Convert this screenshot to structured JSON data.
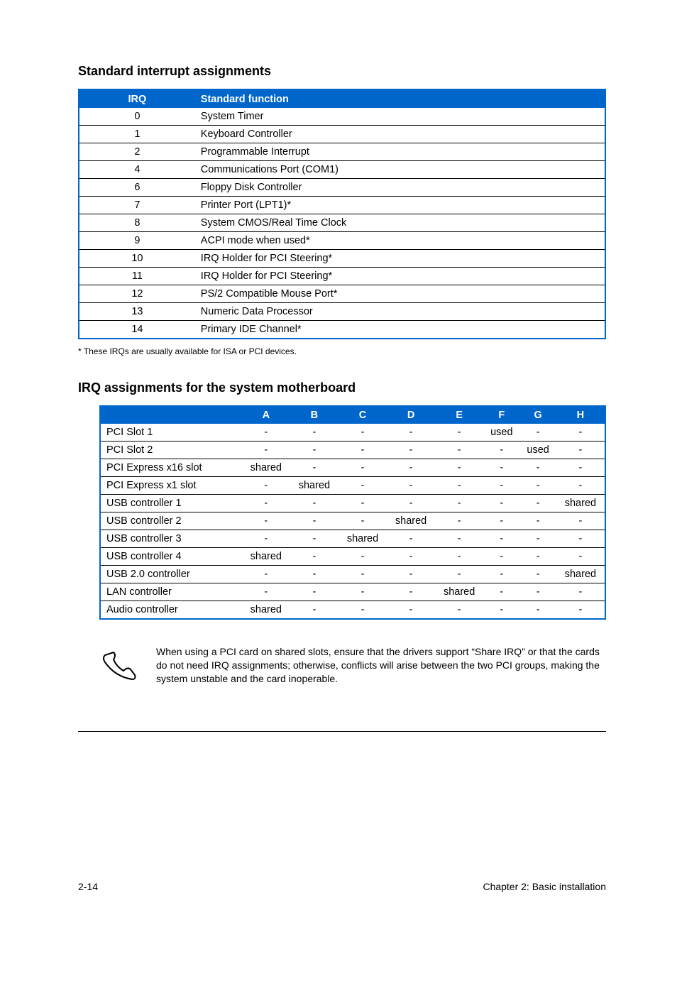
{
  "section1": {
    "title": "Standard interrupt assignments",
    "headers": {
      "irq": "IRQ",
      "func": "Standard function"
    },
    "rows": [
      {
        "irq": "0",
        "func": "System Timer"
      },
      {
        "irq": "1",
        "func": "Keyboard Controller"
      },
      {
        "irq": "2",
        "func": "Programmable Interrupt"
      },
      {
        "irq": "4",
        "func": "Communications Port (COM1)"
      },
      {
        "irq": "6",
        "func": "Floppy Disk Controller"
      },
      {
        "irq": "7",
        "func": "Printer Port (LPT1)*"
      },
      {
        "irq": "8",
        "func": "System CMOS/Real Time Clock"
      },
      {
        "irq": "9",
        "func": "ACPI mode when used*"
      },
      {
        "irq": "10",
        "func": "IRQ Holder for PCI Steering*"
      },
      {
        "irq": "11",
        "func": "IRQ Holder for PCI Steering*"
      },
      {
        "irq": "12",
        "func": "PS/2 Compatible Mouse Port*"
      },
      {
        "irq": "13",
        "func": "Numeric Data Processor"
      },
      {
        "irq": "14",
        "func": "Primary IDE Channel*"
      }
    ],
    "footnote": "* These IRQs are usually available for ISA or PCI devices."
  },
  "section2": {
    "title": "IRQ assignments for the system motherboard",
    "cols": [
      "A",
      "B",
      "C",
      "D",
      "E",
      "F",
      "G",
      "H"
    ],
    "rows": [
      {
        "label": "PCI Slot 1",
        "cells": [
          "-",
          "-",
          "-",
          "-",
          "-",
          "used",
          "-",
          "-"
        ]
      },
      {
        "label": "PCI Slot 2",
        "cells": [
          "-",
          "-",
          "-",
          "-",
          "-",
          "-",
          "used",
          "-"
        ]
      },
      {
        "label": "PCI Express x16 slot",
        "cells": [
          "shared",
          "-",
          "-",
          "-",
          "-",
          "-",
          "-",
          "-"
        ]
      },
      {
        "label": "PCI Express x1 slot",
        "cells": [
          "-",
          "shared",
          "-",
          "-",
          "-",
          "-",
          "-",
          "-"
        ]
      },
      {
        "label": "USB controller 1",
        "cells": [
          "-",
          "-",
          "-",
          "-",
          "-",
          "-",
          "-",
          "shared"
        ]
      },
      {
        "label": "USB controller 2",
        "cells": [
          "-",
          "-",
          "-",
          "shared",
          "-",
          "-",
          "-",
          "-"
        ]
      },
      {
        "label": "USB controller 3",
        "cells": [
          "-",
          "-",
          "shared",
          "-",
          "-",
          "-",
          "-",
          "-"
        ]
      },
      {
        "label": "USB controller 4",
        "cells": [
          "shared",
          "-",
          "-",
          "-",
          "-",
          "-",
          "-",
          "-"
        ]
      },
      {
        "label": "USB 2.0 controller",
        "cells": [
          "-",
          "-",
          "-",
          "-",
          "-",
          "-",
          "-",
          "shared"
        ]
      },
      {
        "label": "LAN controller",
        "cells": [
          "-",
          "-",
          "-",
          "-",
          "shared",
          "-",
          "-",
          "-"
        ]
      },
      {
        "label": "Audio controller",
        "cells": [
          "shared",
          "-",
          "-",
          "-",
          "-",
          "-",
          "-",
          "-"
        ]
      }
    ]
  },
  "note": "When using a PCI card on shared slots, ensure that the drivers support “Share IRQ” or that the cards do not need IRQ assignments; otherwise, conflicts will arise between the two PCI groups, making the system unstable and the card inoperable.",
  "footer": {
    "left": "2-14",
    "right": "Chapter 2: Basic installation"
  }
}
